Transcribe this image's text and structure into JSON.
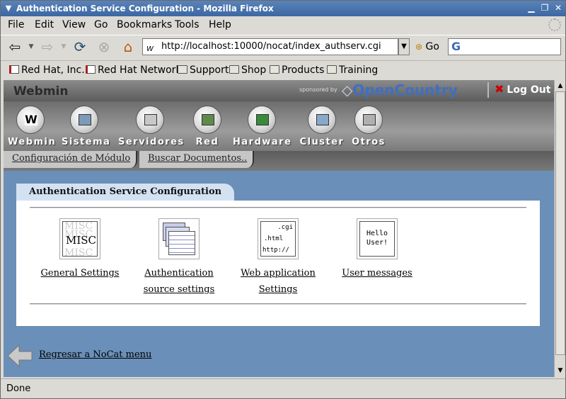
{
  "window": {
    "title": "Authentication Service Configuration - Mozilla Firefox"
  },
  "menubar": [
    "File",
    "Edit",
    "View",
    "Go",
    "Bookmarks",
    "Tools",
    "Help"
  ],
  "navbar": {
    "url": "http://localhost:10000/nocat/index_authserv.cgi",
    "go_label": "Go",
    "favicon": "W"
  },
  "bookmarks": [
    {
      "label": "Red Hat, Inc.",
      "icon": "page-icon"
    },
    {
      "label": "Red Hat Network",
      "icon": "page-icon"
    },
    {
      "label": "Support",
      "icon": "folder-icon"
    },
    {
      "label": "Shop",
      "icon": "folder-icon"
    },
    {
      "label": "Products",
      "icon": "folder-icon"
    },
    {
      "label": "Training",
      "icon": "folder-icon"
    }
  ],
  "webmin": {
    "logo": "Webmin",
    "sponsored": "sponsored by",
    "sponsor_name": "OpenCountry",
    "logout": "Log Out",
    "categories": [
      "Webmin",
      "Sistema",
      "Servidores",
      "Red",
      "Hardware",
      "Cluster",
      "Otros"
    ],
    "tabs": [
      "Configuración de Módulo",
      "Buscar Documentos.."
    ]
  },
  "panel": {
    "title": "Authentication Service Configuration",
    "modules": [
      {
        "line1": "General Settings",
        "line2": ""
      },
      {
        "line1": "Authentication",
        "line2": "source settings"
      },
      {
        "line1": "Web application",
        "line2": "Settings"
      },
      {
        "line1": "User messages",
        "line2": ""
      }
    ],
    "icon_text": {
      "misc": "MISC",
      "cgi": ".cgi",
      "html": ".html",
      "http": "http://",
      "hello1": "Hello",
      "hello2": "User!"
    }
  },
  "back_link": "Regresar a NoCat menu",
  "status": "Done"
}
